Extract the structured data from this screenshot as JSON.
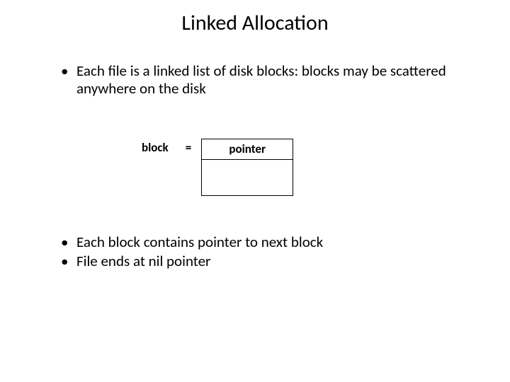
{
  "title": "Linked Allocation",
  "bullets_top": [
    "Each file is a linked list of disk blocks: blocks may be scattered anywhere on the disk"
  ],
  "diagram": {
    "block_label": "block",
    "equals": "=",
    "pointer_label": "pointer"
  },
  "bullets_bottom": [
    "Each block contains pointer to next block",
    "File ends at nil pointer"
  ]
}
